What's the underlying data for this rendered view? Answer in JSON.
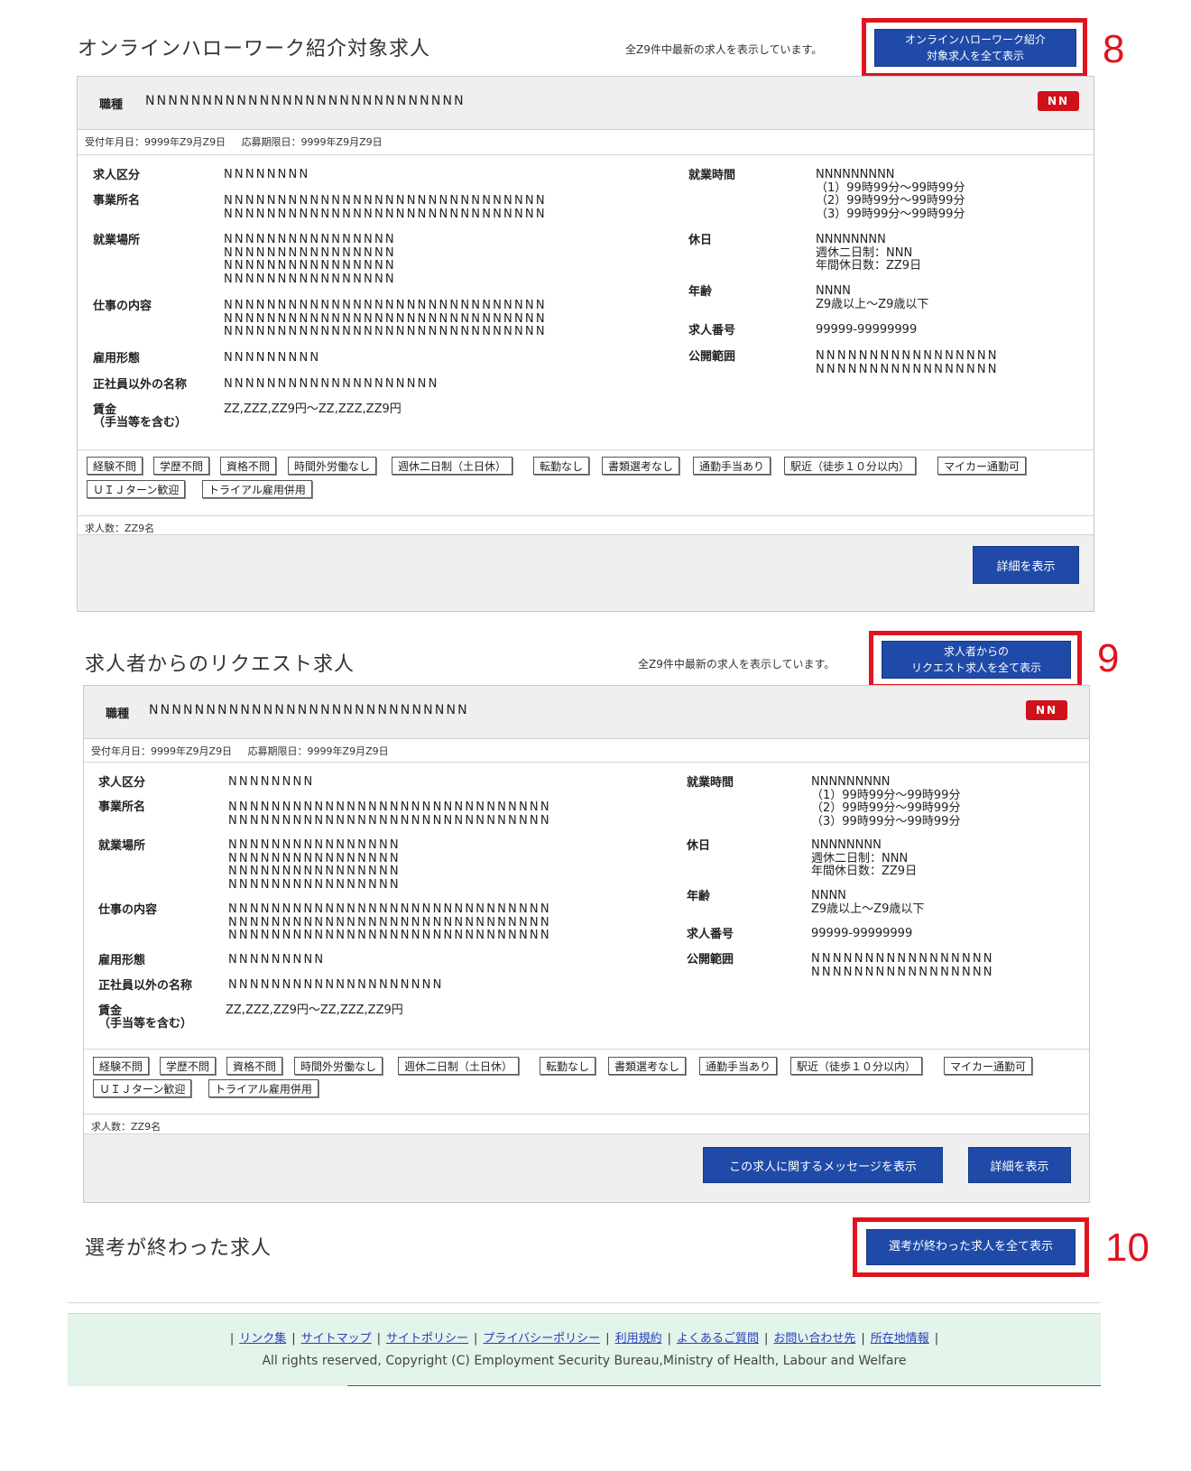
{
  "section1": {
    "title": "オンラインハローワーク紹介対象求人",
    "showing_note": "全Z9件中最新の求人を表示しています。",
    "all_button_line1": "オンラインハローワーク紹介",
    "all_button_line2": "対象求人を全て表示",
    "annotation": "8"
  },
  "section2": {
    "title": "求人者からのリクエスト求人",
    "showing_note": "全Z9件中最新の求人を表示しています。",
    "all_button_line1": "求人者からの",
    "all_button_line2": "リクエスト求人を全て表示",
    "annotation": "9"
  },
  "section3": {
    "title": "選考が終わった求人",
    "all_button": "選考が終わった求人を全て表示",
    "annotation": "10"
  },
  "card": {
    "occupation_label": "職種",
    "occupation_value": "NNNNNNNNNNNNNNNNNNNNNNNNNNNN",
    "badge": "NN",
    "received_date": "受付年月日：9999年Z9月Z9日",
    "deadline": "応募期限日：9999年Z9月Z9日",
    "labels": {
      "category": "求人区分",
      "company": "事業所名",
      "workplace": "就業場所",
      "job_content": "仕事の内容",
      "employment_type": "雇用形態",
      "non_regular_name": "正社員以外の名称",
      "wage_line1": "賃金",
      "wage_line2": "（手当等を含む）",
      "hours": "就業時間",
      "holidays": "休日",
      "age": "年齢",
      "job_number": "求人番号",
      "disclosure": "公開範囲"
    },
    "values": {
      "category": "NNNNNNNN",
      "company": "NNNNNNNNNNNNNNNNNNNNNNNNNNNNNN\nNNNNNNNNNNNNNNNNNNNNNNNNNNNNNN",
      "workplace": "NNNNNNNNNNNNNNNN\nNNNNNNNNNNNNNNNN\nNNNNNNNNNNNNNNNN\nNNNNNNNNNNNNNNNN",
      "job_content": "NNNNNNNNNNNNNNNNNNNNNNNNNNNNNN\nNNNNNNNNNNNNNNNNNNNNNNNNNNNNNN\nNNNNNNNNNNNNNNNNNNNNNNNNNNNNNN",
      "employment_type": "NNNNNNNNN",
      "non_regular_name": "NNNNNNNNNNNNNNNNNNNN",
      "wage": "ZZ,ZZZ,ZZ9円～ZZ,ZZZ,ZZ9円",
      "hours": "NNNNNNNNN\n（1）99時99分～99時99分\n（2）99時99分～99時99分\n（3）99時99分～99時99分",
      "holidays": "NNNNNNNN\n週休二日制：NNN\n年間休日数：ZZ9日",
      "age": "NNNN\nZ9歳以上～Z9歳以下",
      "job_number": "99999-99999999",
      "disclosure": "NNNNNNNNNNNNNNNNN\nNNNNNNNNNNNNNNNNN"
    },
    "tags": [
      "経験不問",
      "学歴不問",
      "資格不問",
      "時間外労働なし",
      "週休二日制（土日休）",
      "転勤なし",
      "書類選考なし",
      "通勤手当あり",
      "駅近（徒歩１０分以内）",
      "マイカー通勤可",
      "ＵＩＪターン歓迎",
      "トライアル雇用併用"
    ],
    "count": "求人数：ZZ9名",
    "detail_button": "詳細を表示",
    "message_button": "この求人に関するメッセージを表示"
  },
  "footer": {
    "links": [
      "リンク集",
      "サイトマップ",
      "サイトポリシー",
      "プライバシーポリシー",
      "利用規約",
      "よくあるご質問",
      "お問い合わせ先",
      "所在地情報"
    ],
    "copyright": "All rights reserved, Copyright (C) Employment Security Bureau,Ministry of Health, Labour and Welfare"
  },
  "colors": {
    "accent_blue": "#1f4aa8",
    "annotation_red": "#e0141e",
    "badge_red": "#d0101a",
    "footer_bg": "#e3f4ea"
  }
}
